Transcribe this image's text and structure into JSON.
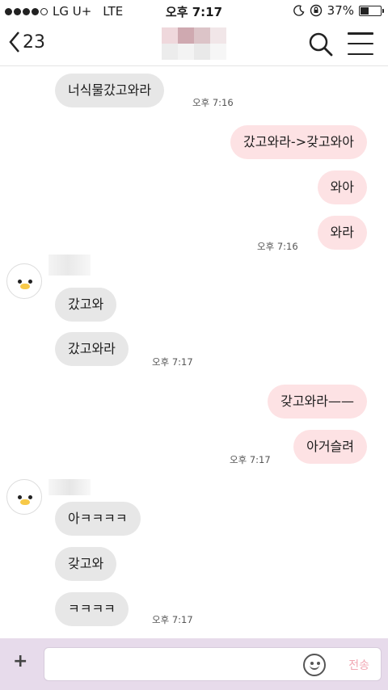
{
  "status_bar": {
    "carrier": "LG U+",
    "network": "LTE",
    "time": "오후 7:17",
    "battery_text": "37%",
    "battery_level": 0.37,
    "signal_bars_filled": 4,
    "signal_bars_total": 5
  },
  "header": {
    "back_count": "23"
  },
  "messages": [
    {
      "id": "m1",
      "text": "너식물갔고와라",
      "time": "오후 7:16"
    },
    {
      "id": "m2",
      "text": "갔고와라->갖고와아"
    },
    {
      "id": "m3",
      "text": "와아"
    },
    {
      "id": "m4",
      "text": "와라",
      "time": "오후 7:16"
    },
    {
      "id": "m5",
      "text": "갔고와"
    },
    {
      "id": "m6",
      "text": "갔고와라",
      "time": "오후 7:17"
    },
    {
      "id": "m7",
      "text": "갖고와라——"
    },
    {
      "id": "m8",
      "text": "아거슬려",
      "time": "오후 7:17"
    },
    {
      "id": "m9",
      "text": "아ㅋㅋㅋㅋ"
    },
    {
      "id": "m10",
      "text": "갖고와"
    },
    {
      "id": "m11",
      "text": "ㅋㅋㅋㅋ",
      "time": "오후 7:17"
    }
  ],
  "input_bar": {
    "plus_label": "+",
    "send_label": "전송"
  },
  "colors": {
    "incoming_bubble": "#e7e7e7",
    "outgoing_bubble": "#fde2e4",
    "input_bar_bg": "#e7dbeb",
    "send_text": "#f1a7b3"
  },
  "icons": [
    "back-chevron-icon",
    "search-icon",
    "menu-icon",
    "emoji-icon",
    "moon-icon",
    "lock-rotation-icon",
    "battery-icon",
    "penguin-avatar-icon"
  ]
}
